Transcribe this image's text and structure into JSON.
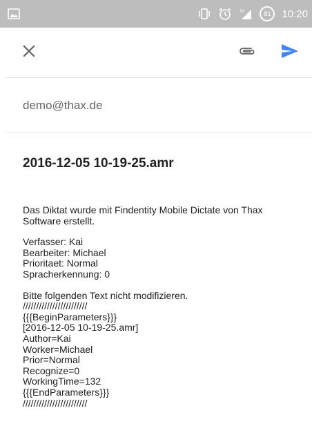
{
  "status_bar": {
    "time": "10:20",
    "battery_level": "81",
    "icons": [
      "image-icon",
      "vibrate-icon",
      "alarm-icon",
      "signal-icon",
      "battery-icon"
    ]
  },
  "toolbar": {
    "close_icon": "close-icon",
    "attach_icon": "paperclip-icon",
    "send_icon": "send-icon"
  },
  "colors": {
    "accent": "#4285f4",
    "status_bar_bg": "#bdbdbd",
    "icon_gray": "#616161"
  },
  "email": {
    "to": "demo@thax.de",
    "subject": "2016-12-05 10-19-25.amr",
    "intro_line1": "Das Diktat wurde mit Findentity Mobile Dictate von Thax",
    "intro_line2": "Software erstellt.",
    "meta": [
      "Verfasser: Kai",
      "Bearbeiter: Michael",
      "Prioritaet: Normal",
      "Spracherkennung: 0"
    ],
    "params": [
      "Bitte folgenden Text nicht modifizieren.",
      "////////////////////////",
      "{{{BeginParameters}}}",
      "[2016-12-05 10-19-25.amr]",
      "Author=Kai",
      "Worker=Michael",
      "Prior=Normal",
      "Recognize=0",
      "WorkingTime=132",
      "{{{EndParameters}}}",
      "////////////////////////"
    ]
  }
}
